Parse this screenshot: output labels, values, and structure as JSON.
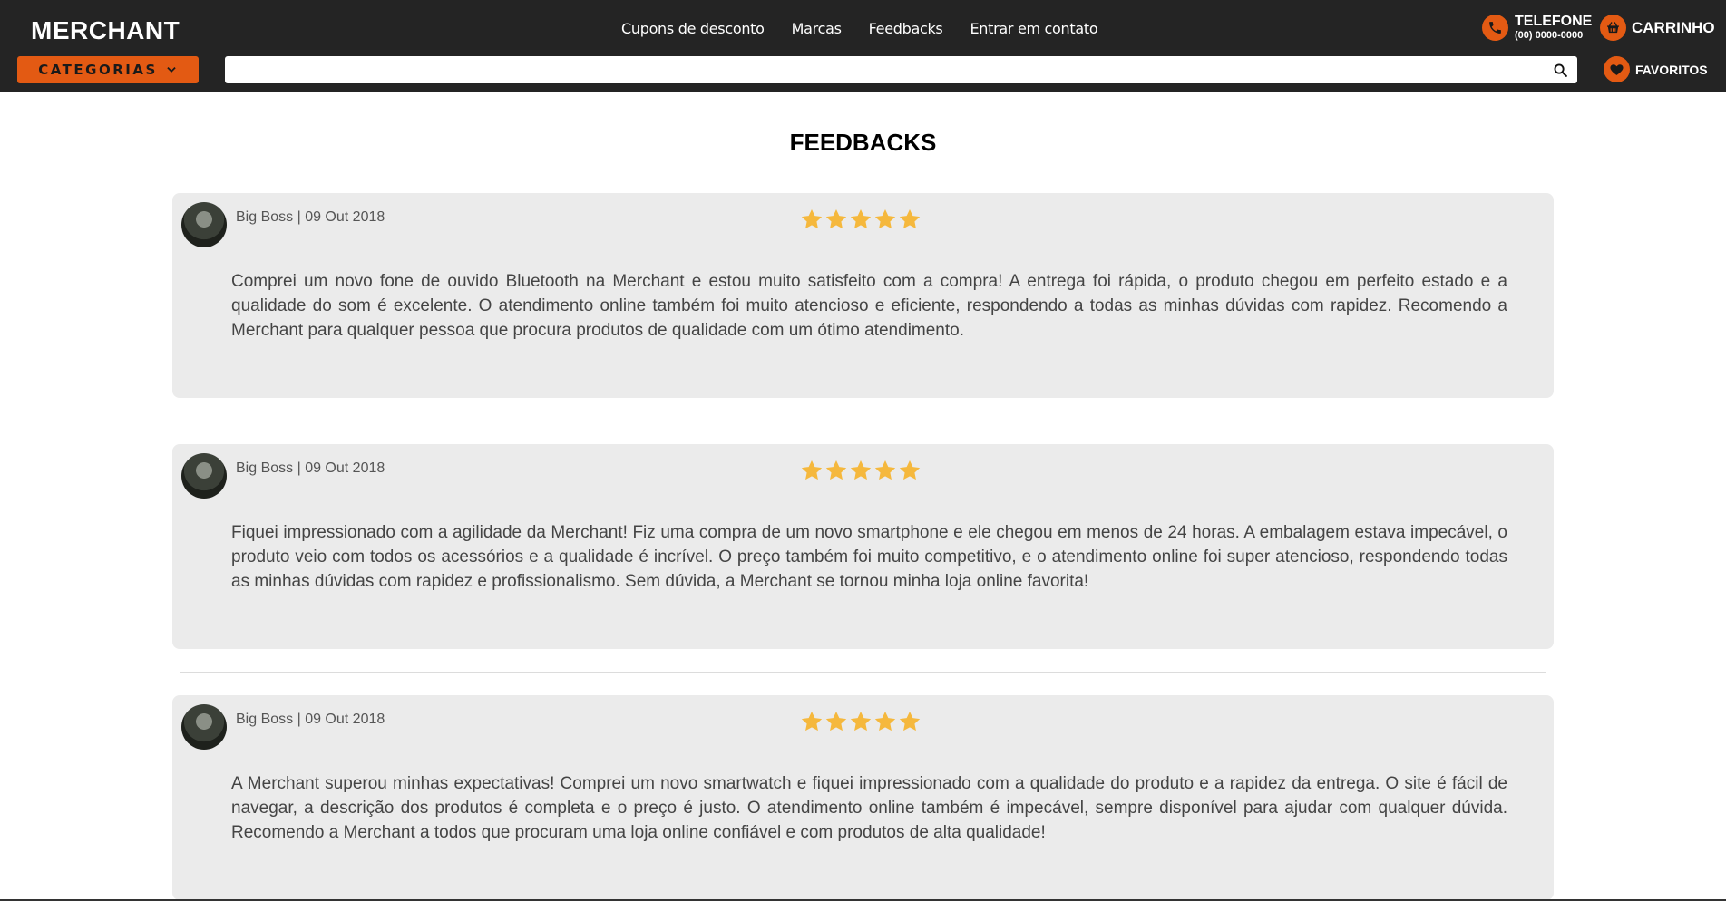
{
  "header": {
    "logo": "MERCHANT",
    "nav": [
      "Cupons de desconto",
      "Marcas",
      "Feedbacks",
      "Entrar em contato"
    ],
    "phone_label": "TELEFONE",
    "phone_number": "(00) 0000-0000",
    "cart_label": "CARRINHO",
    "favorites_label": "FAVORITOS",
    "categories_label": "CATEGORIAS",
    "search_placeholder": ""
  },
  "page": {
    "title": "FEEDBACKS"
  },
  "reviews": [
    {
      "author": "Big Boss",
      "date": "09 Out 2018",
      "rating": 5,
      "text": "Comprei um novo fone de ouvido Bluetooth na Merchant e estou muito satisfeito com a compra! A entrega foi rápida, o produto chegou em perfeito estado e a qualidade do som é excelente. O atendimento online também foi muito atencioso e eficiente, respondendo a todas as minhas dúvidas com rapidez. Recomendo a Merchant para qualquer pessoa que procura produtos de qualidade com um ótimo atendimento."
    },
    {
      "author": "Big Boss",
      "date": "09 Out 2018",
      "rating": 5,
      "text": "Fiquei impressionado com a agilidade da Merchant! Fiz uma compra de um novo smartphone e ele chegou em menos de 24 horas. A embalagem estava impecável, o produto veio com todos os acessórios e a qualidade é incrível. O preço também foi muito competitivo, e o atendimento online foi super atencioso, respondendo todas as minhas dúvidas com rapidez e profissionalismo. Sem dúvida, a Merchant se tornou minha loja online favorita!"
    },
    {
      "author": "Big Boss",
      "date": "09 Out 2018",
      "rating": 5,
      "text": "A Merchant superou minhas expectativas! Comprei um novo smartwatch e fiquei impressionado com a qualidade do produto e a rapidez da entrega. O site é fácil de navegar, a descrição dos produtos é completa e o preço é justo. O atendimento online também é impecável, sempre disponível para ajudar com qualquer dúvida. Recomendo a Merchant a todos que procuram uma loja online confiável e com produtos de alta qualidade!"
    }
  ],
  "colors": {
    "accent": "#e35a13",
    "header_bg": "#242424",
    "card_bg": "#ebebeb",
    "star": "#f5b83d"
  },
  "icons": {
    "phone": "phone-icon",
    "cart": "basket-icon",
    "favorites": "heart-icon",
    "search": "search-icon",
    "categories": "chevron-down-icon",
    "rating": "star-icon"
  }
}
